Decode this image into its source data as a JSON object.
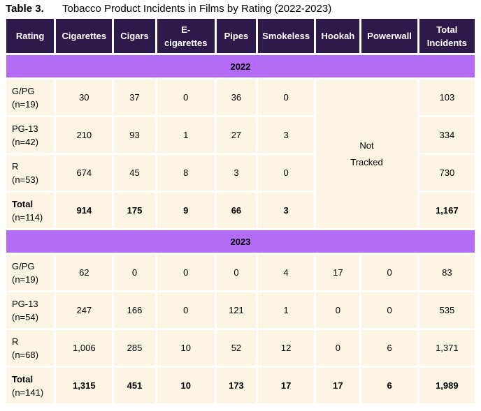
{
  "caption": {
    "number": "Table 3.",
    "title": "Tobacco Product Incidents in Films by Rating (2022-2023)"
  },
  "headers": [
    "Rating",
    "Cigarettes",
    "Cigars",
    "E-cigarettes",
    "Pipes",
    "Smokeless",
    "Hookah",
    "Powerwall",
    "Total Incidents"
  ],
  "header_lines": {
    "ecig_1": "E-",
    "ecig_2": "cigarettes",
    "total_1": "Total",
    "total_2": "Incidents"
  },
  "years": [
    "2022",
    "2023"
  ],
  "not_tracked": {
    "line1": "Not",
    "line2": "Tracked"
  },
  "rows_2022": [
    {
      "rating": "G/PG",
      "n": "(n=19)",
      "cigarettes": "30",
      "cigars": "37",
      "ecig": "0",
      "pipes": "36",
      "smokeless": "0",
      "total": "103"
    },
    {
      "rating": "PG-13",
      "n": "(n=42)",
      "cigarettes": "210",
      "cigars": "93",
      "ecig": "1",
      "pipes": "27",
      "smokeless": "3",
      "total": "334"
    },
    {
      "rating": "R",
      "n": "(n=53)",
      "cigarettes": "674",
      "cigars": "45",
      "ecig": "8",
      "pipes": "3",
      "smokeless": "0",
      "total": "730"
    },
    {
      "rating": "Total",
      "n": "(n=114)",
      "cigarettes": "914",
      "cigars": "175",
      "ecig": "9",
      "pipes": "66",
      "smokeless": "3",
      "total": "1,167"
    }
  ],
  "rows_2023": [
    {
      "rating": "G/PG",
      "n": "(n=19)",
      "cigarettes": "62",
      "cigars": "0",
      "ecig": "0",
      "pipes": "0",
      "smokeless": "4",
      "hookah": "17",
      "powerwall": "0",
      "total": "83"
    },
    {
      "rating": "PG-13",
      "n": "(n=54)",
      "cigarettes": "247",
      "cigars": "166",
      "ecig": "0",
      "pipes": "121",
      "smokeless": "1",
      "hookah": "0",
      "powerwall": "0",
      "total": "535"
    },
    {
      "rating": "R",
      "n": "(n=68)",
      "cigarettes": "1,006",
      "cigars": "285",
      "ecig": "10",
      "pipes": "52",
      "smokeless": "12",
      "hookah": "0",
      "powerwall": "6",
      "total": "1,371"
    },
    {
      "rating": "Total",
      "n": "(n=141)",
      "cigarettes": "1,315",
      "cigars": "451",
      "ecig": "10",
      "pipes": "173",
      "smokeless": "17",
      "hookah": "17",
      "powerwall": "6",
      "total": "1,989"
    }
  ]
}
